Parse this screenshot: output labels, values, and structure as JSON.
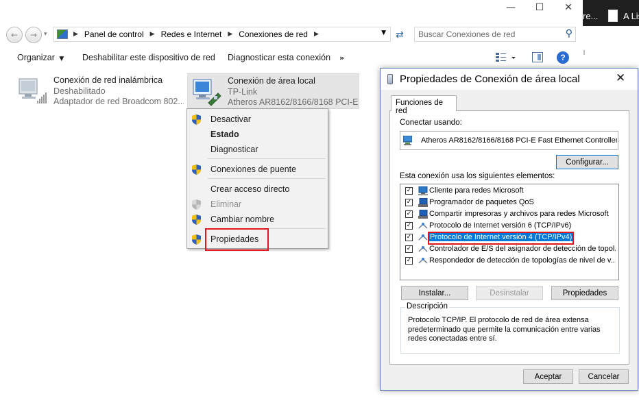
{
  "explorer": {
    "breadcrumbs": [
      "Panel de control",
      "Redes e Internet",
      "Conexiones de red"
    ],
    "search_placeholder": "Buscar Conexiones de red",
    "toolbar": {
      "organize": "Organizar",
      "disable": "Deshabilitar este dispositivo de red",
      "diagnose": "Diagnosticar esta conexión",
      "more": "»"
    },
    "connections": [
      {
        "name": "Conexión de red inalámbrica",
        "status": "Deshabilitado",
        "adapter": "Adaptador de red Broadcom 802...."
      },
      {
        "name": "Conexión de área local",
        "status": "TP-Link",
        "adapter": "Atheros AR8162/8166/8168 PCI-E ..."
      }
    ]
  },
  "context_menu": {
    "items": [
      {
        "label": "Desactivar",
        "shield": true,
        "bold": false,
        "disabled": false
      },
      {
        "label": "Estado",
        "shield": false,
        "bold": true,
        "disabled": false
      },
      {
        "label": "Diagnosticar",
        "shield": false,
        "bold": false,
        "disabled": false
      },
      {
        "label": "Conexiones de puente",
        "shield": true,
        "bold": false,
        "disabled": false
      },
      {
        "label": "Crear acceso directo",
        "shield": false,
        "bold": false,
        "disabled": false
      },
      {
        "label": "Eliminar",
        "shield": true,
        "bold": false,
        "disabled": true
      },
      {
        "label": "Cambiar nombre",
        "shield": true,
        "bold": false,
        "disabled": false
      },
      {
        "label": "Propiedades",
        "shield": true,
        "bold": false,
        "disabled": false,
        "highlighted": true
      }
    ]
  },
  "background_taskbar": {
    "item1": "re...",
    "item2": "A Lis"
  },
  "dialog": {
    "title": "Propiedades de Conexión de área local",
    "tab": "Funciones de red",
    "connect_using_label": "Conectar usando:",
    "adapter": "Atheros AR8162/8166/8168 PCI-E Fast Ethernet Controller",
    "configure_button": "Configurar...",
    "items_label": "Esta conexión usa los siguientes elementos:",
    "components": [
      {
        "label": "Cliente para redes Microsoft",
        "checked": true,
        "icon": "network-client-icon"
      },
      {
        "label": "Programador de paquetes QoS",
        "checked": true,
        "icon": "network-service-icon"
      },
      {
        "label": "Compartir impresoras y archivos para redes Microsoft",
        "checked": true,
        "icon": "network-service-icon"
      },
      {
        "label": "Protocolo de Internet versión 6 (TCP/IPv6)",
        "checked": true,
        "icon": "protocol-icon"
      },
      {
        "label": "Protocolo de Internet versión 4 (TCP/IPv4)",
        "checked": true,
        "icon": "protocol-icon",
        "selected": true
      },
      {
        "label": "Controlador de E/S del asignador de detección de topol...",
        "checked": true,
        "icon": "protocol-icon"
      },
      {
        "label": "Respondedor de detección de topologías de nivel de v...",
        "checked": true,
        "icon": "protocol-icon"
      }
    ],
    "install_button": "Instalar...",
    "uninstall_button": "Desinstalar",
    "properties_button": "Propiedades",
    "description_title": "Descripción",
    "description_text": "Protocolo TCP/IP. El protocolo de red de área extensa predeterminado que permite la comunicación entre varias redes conectadas entre sí.",
    "ok_button": "Aceptar",
    "cancel_button": "Cancelar"
  },
  "colors": {
    "highlight_red": "#e0161c",
    "selection_blue": "#0078d7",
    "shield_blue": "#2c5fbf",
    "shield_yellow": "#f4c20d"
  }
}
